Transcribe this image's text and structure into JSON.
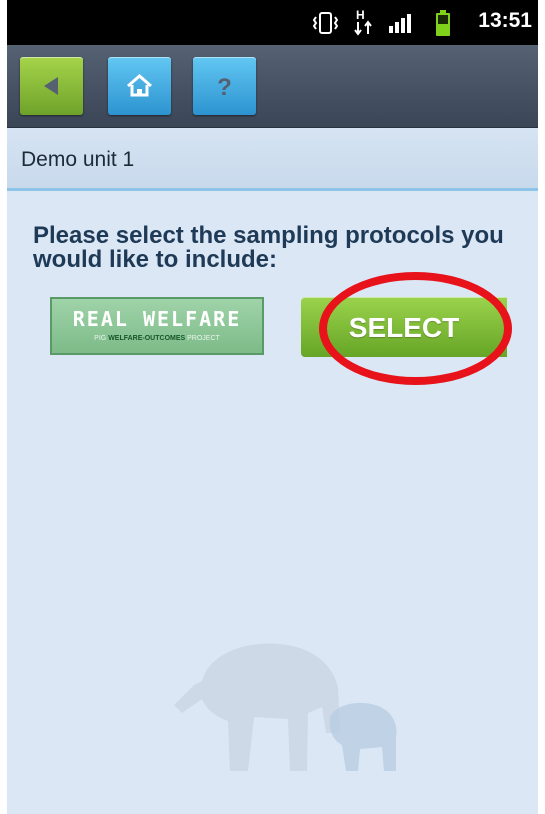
{
  "status_bar": {
    "time": "13:51",
    "icons": [
      "vibrate-icon",
      "hspa-data-icon",
      "signal-icon",
      "battery-icon"
    ]
  },
  "toolbar": {
    "buttons": [
      {
        "icon": "back-arrow-icon",
        "color": "#8cc13a"
      },
      {
        "icon": "home-icon",
        "color": "#3aaee4"
      },
      {
        "icon": "help-icon",
        "color": "#3aaee4"
      }
    ]
  },
  "header": {
    "title": "Demo unit 1"
  },
  "main": {
    "prompt": "Please select the sampling protocols you would like to include:",
    "protocol_logo": {
      "title": "REAL WELFARE",
      "subtitle_pre": "PIG ",
      "subtitle_bold": "WELFARE-OUTCOMES",
      "subtitle_post": " PROJECT"
    },
    "select_button": {
      "label": "SELECT",
      "color": "#7fbf37"
    },
    "highlight": {
      "color": "#e8121b"
    }
  }
}
